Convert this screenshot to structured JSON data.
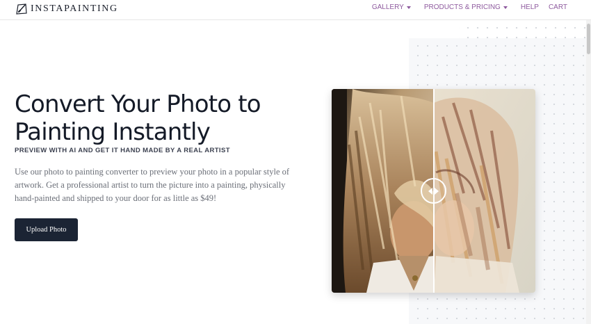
{
  "brand": {
    "name": "INSTAPAINTING",
    "icon": "paint-canvas-logo-icon"
  },
  "nav": {
    "gallery": "GALLERY",
    "products": "PRODUCTS & PRICING",
    "help": "HELP",
    "cart": "CART",
    "dropdown_icon": "caret-down-icon",
    "link_color": "#8e5a9e"
  },
  "hero": {
    "title_line1": "Convert Your Photo to",
    "title_line2": "Painting Instantly",
    "subtitle": "PREVIEW WITH AI AND GET IT HAND MADE BY A REAL ARTIST",
    "description": "Use our photo to painting converter to preview your photo in a popular style of artwork. Get a professional artist to turn the picture into a painting, physically hand-painted and shipped to your door for as little as $49!",
    "cta_label": "Upload Photo",
    "cta_color": "#1b2434"
  },
  "comparison": {
    "left_image": "original-photo",
    "right_image": "painted-version",
    "handle_icon": "left-right-arrows-icon",
    "split_percent": 50
  }
}
